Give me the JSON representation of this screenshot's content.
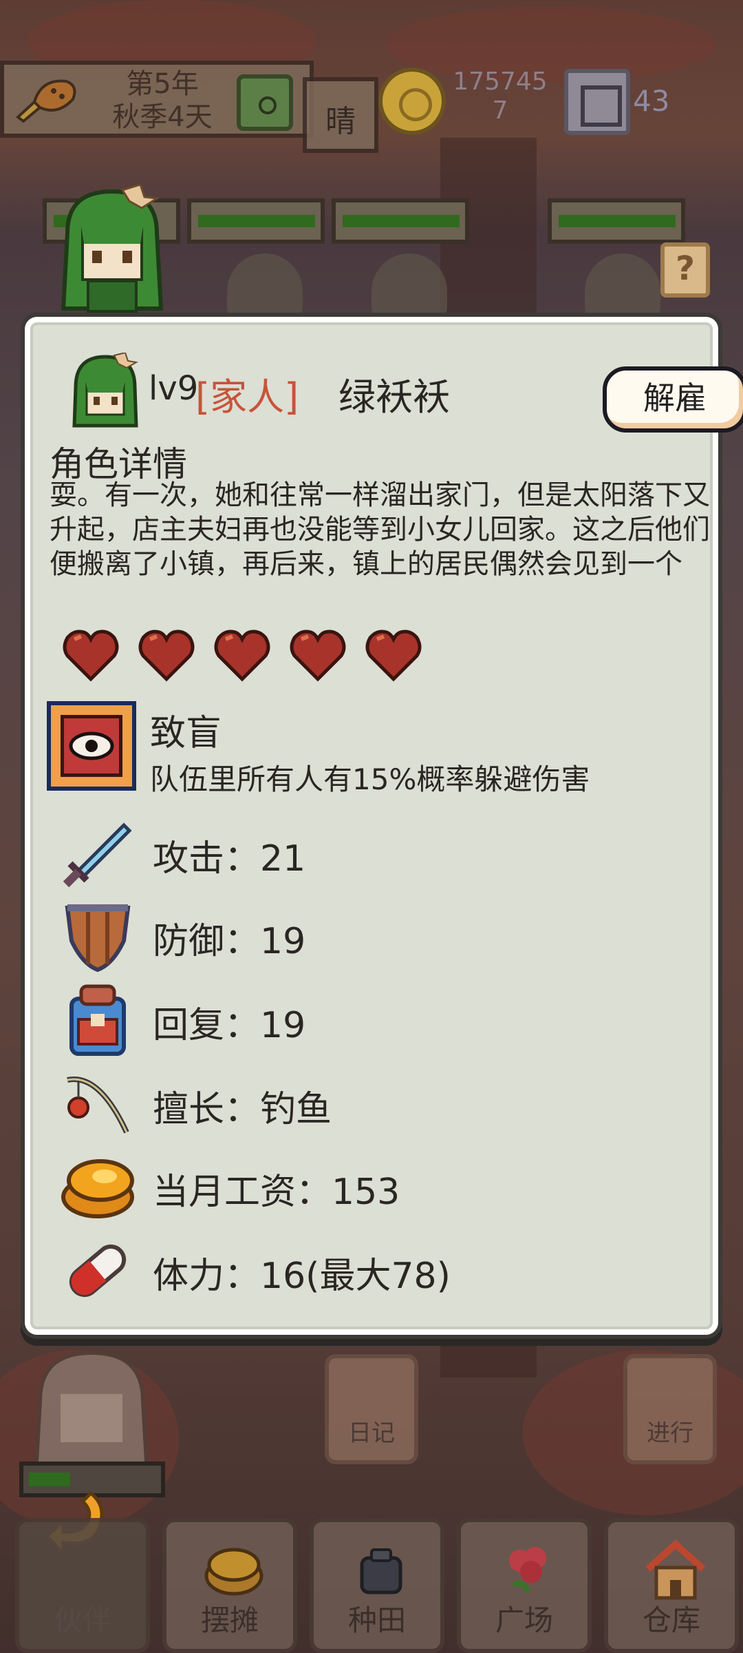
{
  "hud": {
    "date_line1": "第5年",
    "date_line2": "秋季4天",
    "weather": "晴",
    "money_line1": "175745",
    "money_line2": "7",
    "gems": "43"
  },
  "help": {
    "label": "?"
  },
  "character": {
    "level": "lv9",
    "tag": "[家人]",
    "name": "绿袄袄",
    "fire_button": "解雇",
    "details_title": "角色详情",
    "description": "耍。有一次，她和往常一样溜出家门，但是太阳落下又升起，店主夫妇再也没能等到小女儿回家。这之后他们便搬离了小镇，再后来，镇上的居民偶然会见到一个",
    "hearts_filled": 5,
    "hearts_total": 5,
    "skill": {
      "name": "致盲",
      "description": "队伍里所有人有15%概率躲避伤害"
    },
    "stats": {
      "attack": "攻击：21",
      "defense": "防御：19",
      "recovery": "回复：19",
      "specialty": "擅长：钓鱼",
      "salary": "当月工资：153",
      "stamina": "体力：16(最大78)"
    }
  },
  "actions": {
    "diary": "日记",
    "proceed": "进行"
  },
  "nav": {
    "partner": "伙伴",
    "stall": "摆摊",
    "farm": "种田",
    "plaza": "广场",
    "warehouse": "仓库"
  },
  "colors": {
    "tag_red": "#c8533a",
    "modal_bg": "#dcdfd4",
    "hp_green": "#2f6a1e"
  }
}
